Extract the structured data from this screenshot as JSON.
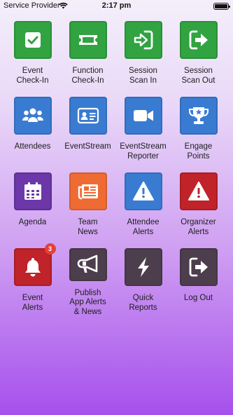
{
  "status_bar": {
    "carrier": "Service Provider",
    "time": "2:17 pm"
  },
  "tiles": [
    {
      "label": "Event\nCheck-In",
      "icon": "checkbox-icon",
      "color": "#31a341"
    },
    {
      "label": "Function\nCheck-In",
      "icon": "ticket-icon",
      "color": "#31a341"
    },
    {
      "label": "Session\nScan In",
      "icon": "sign-in-icon",
      "color": "#31a341"
    },
    {
      "label": "Session\nScan Out",
      "icon": "sign-out-icon",
      "color": "#31a341"
    },
    {
      "label": "Attendees",
      "icon": "users-icon",
      "color": "#3a7bd2"
    },
    {
      "label": "EventStream",
      "icon": "id-card-icon",
      "color": "#3a7bd2"
    },
    {
      "label": "EventStream\nReporter",
      "icon": "video-camera-icon",
      "color": "#3a7bd2"
    },
    {
      "label": "Engage\nPoints",
      "icon": "trophy-icon",
      "color": "#3a7bd2"
    },
    {
      "label": "Agenda",
      "icon": "calendar-icon",
      "color": "#6b37a9"
    },
    {
      "label": "Team\nNews",
      "icon": "newspaper-icon",
      "color": "#ef6b34"
    },
    {
      "label": "Attendee\nAlerts",
      "icon": "warning-icon",
      "color": "#3a7bd2"
    },
    {
      "label": "Organizer\nAlerts",
      "icon": "warning-icon",
      "color": "#c02329"
    },
    {
      "label": "Event\nAlerts",
      "icon": "bell-icon",
      "color": "#c02329",
      "badge": "3"
    },
    {
      "label": "Publish\nApp Alerts\n& News",
      "icon": "megaphone-icon",
      "color": "#4d3e4d"
    },
    {
      "label": "Quick\nReports",
      "icon": "lightning-icon",
      "color": "#4d3e4d"
    },
    {
      "label": "Log Out",
      "icon": "sign-out-icon",
      "color": "#4d3e4d"
    }
  ]
}
